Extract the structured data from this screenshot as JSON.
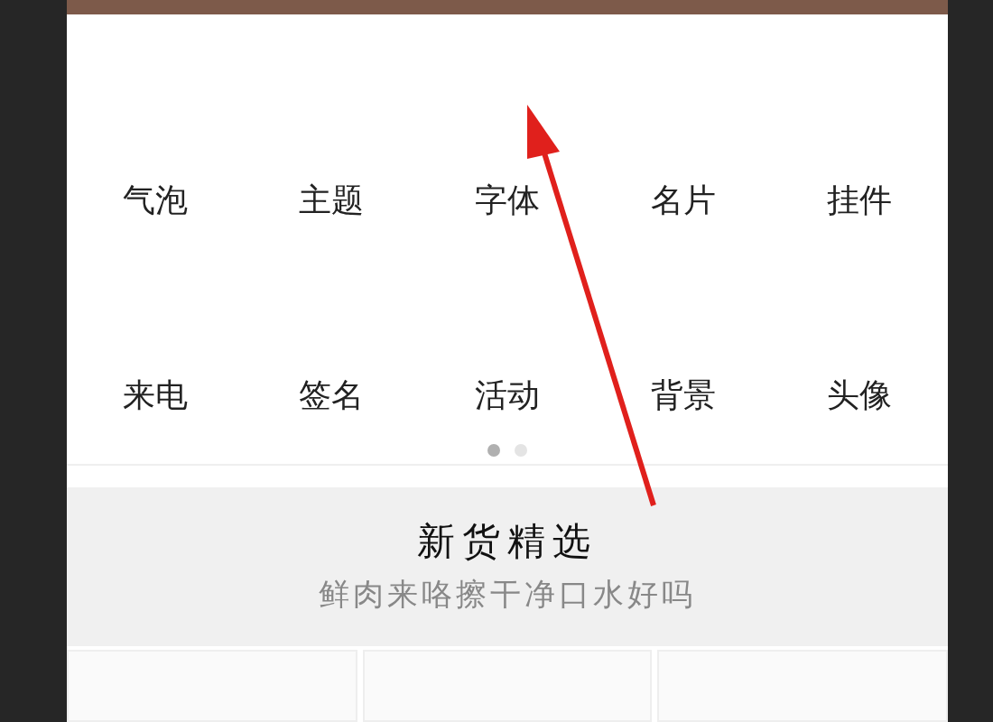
{
  "grid_pages": [
    {
      "items": [
        {
          "label": "气泡"
        },
        {
          "label": "主题"
        },
        {
          "label": "字体"
        },
        {
          "label": "名片"
        },
        {
          "label": "挂件"
        },
        {
          "label": "来电"
        },
        {
          "label": "签名"
        },
        {
          "label": "活动"
        },
        {
          "label": "背景"
        },
        {
          "label": "头像"
        }
      ]
    }
  ],
  "pager": [
    {
      "selected": true
    },
    {
      "selected": false
    }
  ],
  "section": {
    "title": "新货精选",
    "subtitle": "鲜肉来咯擦干净口水好吗"
  },
  "product_cards": [
    {
      "kind": "card"
    },
    {
      "kind": "card"
    },
    {
      "kind": "card"
    }
  ]
}
